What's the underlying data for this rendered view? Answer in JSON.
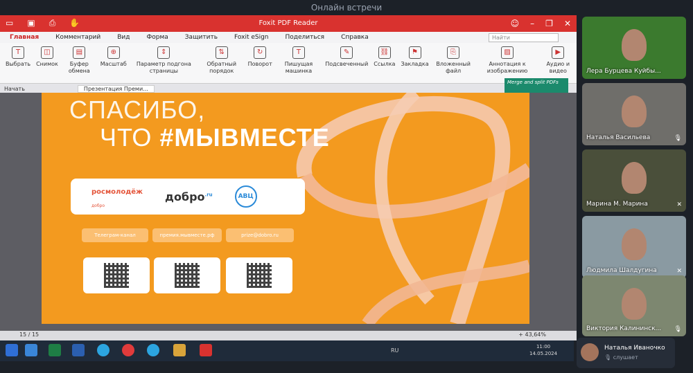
{
  "meeting": {
    "title": "Онлайн встречи"
  },
  "app": {
    "window_title": "Foxit PDF Reader",
    "menu": [
      "Главная",
      "Комментарий",
      "Вид",
      "Форма",
      "Защитить",
      "Foxit eSign",
      "Поделиться",
      "Справка"
    ],
    "search_hint": "Найти",
    "ribbon": [
      "Выбрать",
      "Снимок",
      "Буфер обмена",
      "Масштаб",
      "Параметр подгона страницы",
      "Обратный порядок",
      "Поворот",
      "Пишущая машинка",
      "Подсвеченный",
      "Ссылка",
      "Закладка",
      "Вложенный файл",
      "Аннотация к изображению",
      "Аудио и видео"
    ],
    "tabs": {
      "start": "Начать",
      "doc": "Презентация Преми..."
    },
    "merge_banner": "Merge and split PDFs",
    "page_indicator": "15 / 15",
    "zoom": "+ 43,64%"
  },
  "slide": {
    "line1": "СПАСИБО,",
    "line2_prefix": "ЧТО ",
    "line2_bold": "#МЫВМЕСТЕ",
    "logos": [
      "росмолодёж",
      "добро",
      "АВЦ"
    ],
    "logo_sub": "добро",
    "dobro_sup": ".ru",
    "pills": [
      "Телеграм-канал",
      "премия.мывместе.рф",
      "prize@dobro.ru"
    ]
  },
  "taskbar": {
    "lang": "RU",
    "time": "11:00",
    "date": "14.05.2024"
  },
  "participants": [
    {
      "name": "Лера Бурцева Куйбы...",
      "bg": "#3b7a2e"
    },
    {
      "name": "Наталья Васильева",
      "bg": "#6f6e6a"
    },
    {
      "name": "Марина М. Марина",
      "bg": "#4a4f3a"
    },
    {
      "name": "Людмила Шалдугина",
      "bg": "#8a9aa2"
    },
    {
      "name": "Виктория Калининск...",
      "bg": "#7d8770"
    }
  ],
  "speaker": {
    "name": "Наталья Иваночко",
    "status": "слушает"
  }
}
